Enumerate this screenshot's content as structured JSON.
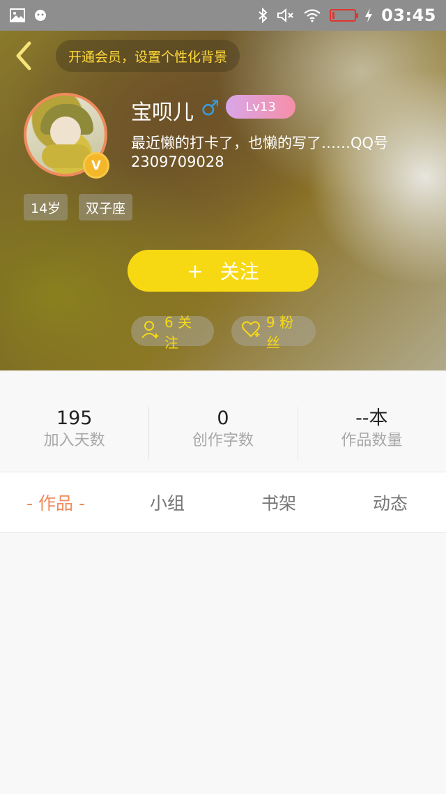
{
  "status_bar": {
    "time": "03:45",
    "left_icons": [
      "image-icon",
      "notification-icon"
    ],
    "right_icons": [
      "bluetooth-icon",
      "mute-icon",
      "wifi-icon",
      "battery-icon",
      "charging-icon"
    ],
    "battery_color": "#e0362f"
  },
  "header": {
    "vip_banner": "开通会员，设置个性化背景",
    "nickname": "宝呗儿",
    "gender_symbol": "♂",
    "level": "Lv13",
    "verified_badge": "V",
    "bio": "最近懒的打卡了，也懒的写了……QQ号2309709028",
    "tags": [
      "14岁",
      "双子座"
    ],
    "follow_button": {
      "icon": "+",
      "label": "关注"
    },
    "following": "6 关注",
    "fans": "9 粉丝"
  },
  "stats": [
    {
      "value": "195",
      "label": "加入天数"
    },
    {
      "value": "0",
      "label": "创作字数"
    },
    {
      "value": "--本",
      "label": "作品数量"
    }
  ],
  "tabs": [
    {
      "label": "- 作品 -",
      "active": true
    },
    {
      "label": "小组",
      "active": false
    },
    {
      "label": "书架",
      "active": false
    },
    {
      "label": "动态",
      "active": false
    }
  ],
  "colors": {
    "accent_yellow": "#f7d913",
    "active_tab": "#f08a5c",
    "gender_male": "#3a9bdc"
  }
}
